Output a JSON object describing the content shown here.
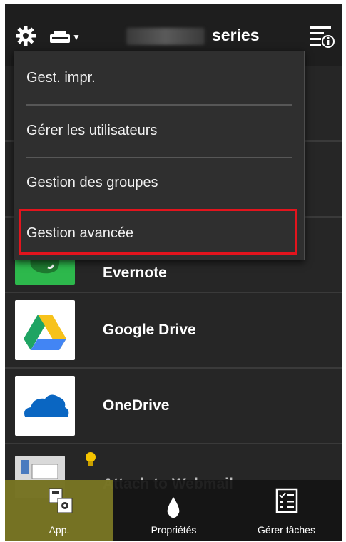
{
  "header": {
    "series_label": "series",
    "icons": [
      "gear-icon",
      "printer-icon",
      "chevron-down-icon",
      "info-list-icon"
    ]
  },
  "menu": {
    "items": [
      {
        "label": "Gest. impr."
      },
      {
        "label": "Gérer les utilisateurs"
      },
      {
        "label": "Gestion des groupes"
      },
      {
        "label": "Gestion avancée",
        "highlighted": true
      }
    ]
  },
  "apps": [
    {
      "label": "Evernote",
      "icon": "evernote-icon"
    },
    {
      "label": "Google Drive",
      "icon": "google-drive-icon"
    },
    {
      "label": "OneDrive",
      "icon": "onedrive-icon"
    },
    {
      "label": "Attach to Webmail",
      "icon": "webmail-icon"
    }
  ],
  "bottom_bar": {
    "tabs": [
      {
        "label": "App.",
        "icon": "apps-icon",
        "active": true
      },
      {
        "label": "Propriétés",
        "icon": "ink-drop-icon"
      },
      {
        "label": "Gérer tâches",
        "icon": "task-list-icon"
      }
    ]
  },
  "colors": {
    "highlight_border": "#e3141d",
    "active_tab": "#969128",
    "background": "#262626"
  }
}
